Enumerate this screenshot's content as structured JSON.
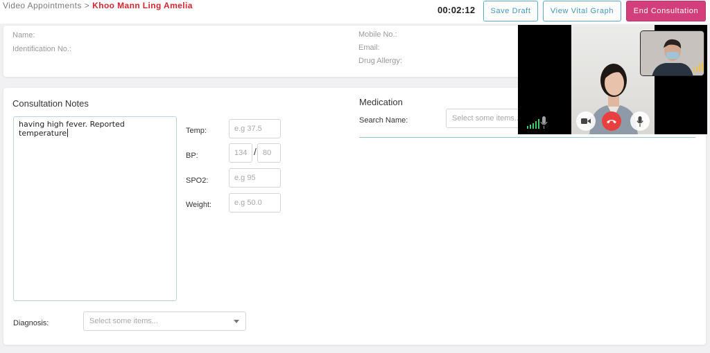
{
  "breadcrumb": {
    "parent": "Video Appointments",
    "separator": ">",
    "current": "Khoo Mann Ling Amelia"
  },
  "header": {
    "timer": "00:02:12",
    "save_draft_label": "Save Draft",
    "view_vital_label": "View Vital Graph",
    "end_consultation_label": "End Consultation"
  },
  "patient_info": {
    "name_label": "Name:",
    "id_label": "Identification No.:",
    "mobile_label": "Mobile No.:",
    "email_label": "Email:",
    "allergy_label": "Drug Allergy:"
  },
  "consultation": {
    "title": "Consultation Notes",
    "notes_value": "having high fever. Reported temperature"
  },
  "vitals": {
    "temp_label": "Temp:",
    "temp_placeholder": "e.g 37.5",
    "bp_label": "BP:",
    "bp_sys_placeholder": "134",
    "bp_separator": "/",
    "bp_dia_placeholder": "80",
    "spo2_label": "SPO2:",
    "spo2_placeholder": "e.g 95",
    "weight_label": "Weight:",
    "weight_placeholder": "e.g 50.0"
  },
  "diagnosis": {
    "label": "Diagnosis:",
    "placeholder": "Select some items..."
  },
  "medication": {
    "title": "Medication",
    "search_label": "Search Name:",
    "placeholder": "Select some items..."
  },
  "video": {
    "controls": [
      "camera-icon",
      "hang-up-icon",
      "microphone-icon"
    ],
    "colors": {
      "hang_up": "#e8403f",
      "signal": "#3fcf6a"
    }
  },
  "colors": {
    "accent": "#3e95bf",
    "end_button": "#d23f7b",
    "patient_name": "#d4252e"
  }
}
